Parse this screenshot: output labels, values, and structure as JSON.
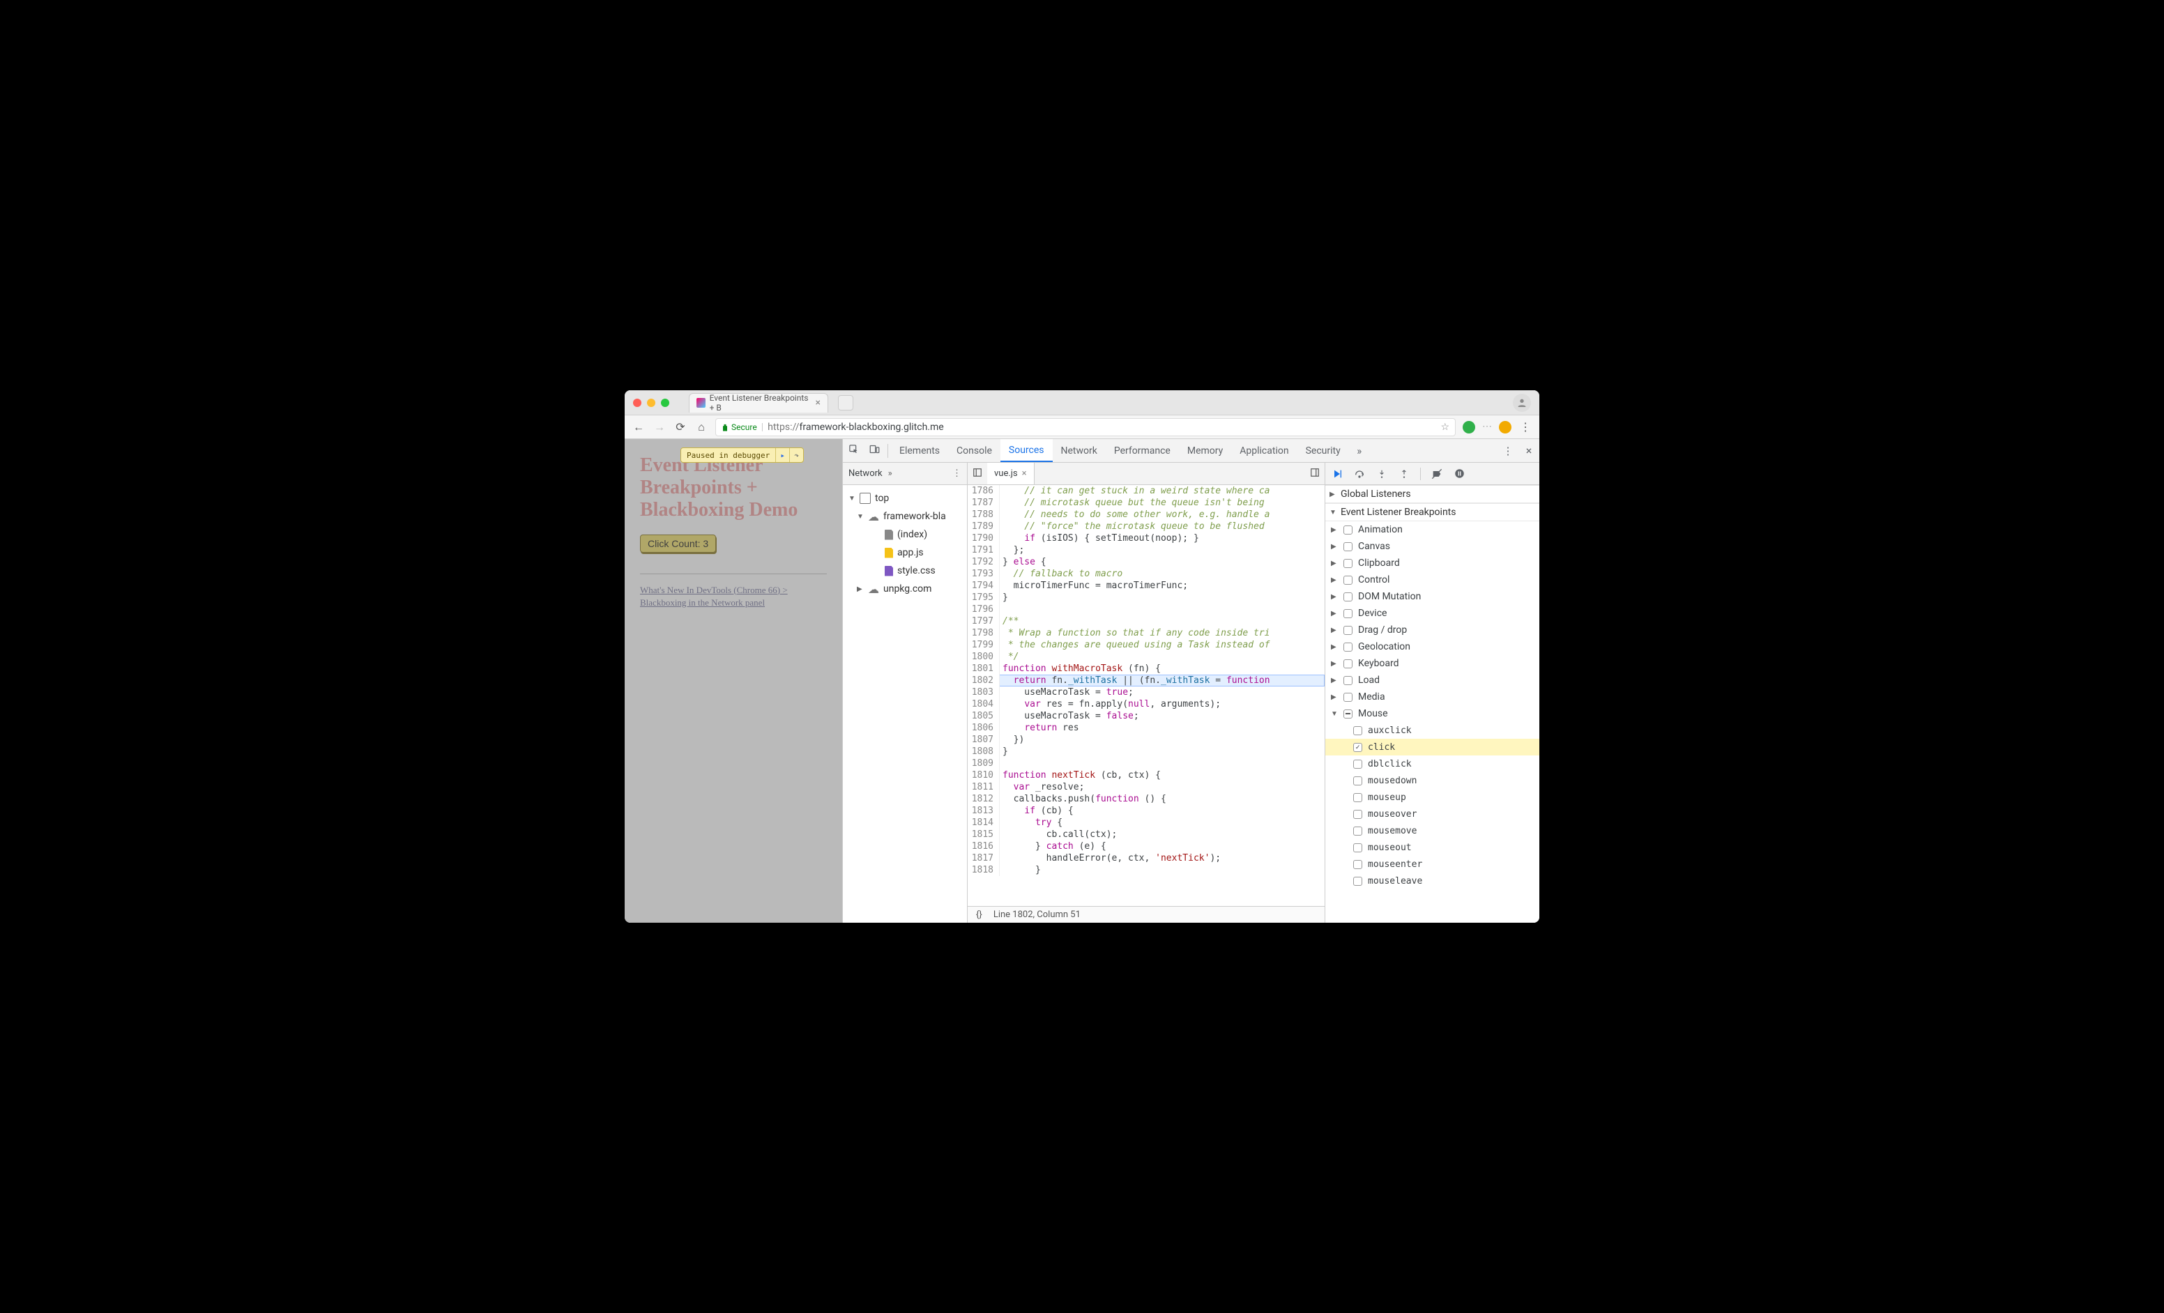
{
  "browser": {
    "tab_title": "Event Listener Breakpoints + B",
    "secure_label": "Secure",
    "url_scheme": "https://",
    "url_host_path": "framework-blackboxing.glitch.me"
  },
  "page": {
    "paused_label": "Paused in debugger",
    "heading": "Event Listener Breakpoints + Blackboxing Demo",
    "click_button": "Click Count: 3",
    "link_text": "What's New In DevTools (Chrome 66) > Blackboxing in the Network panel"
  },
  "devtools": {
    "tabs": [
      "Elements",
      "Console",
      "Sources",
      "Network",
      "Performance",
      "Memory",
      "Application",
      "Security"
    ],
    "active_tab": "Sources",
    "overflow": "»"
  },
  "navigator": {
    "tab": "Network",
    "overflow": "»",
    "tree": {
      "top": "top",
      "host": "framework-bla",
      "files": [
        "(index)",
        "app.js",
        "style.css"
      ],
      "other_host": "unpkg.com"
    }
  },
  "editor": {
    "tab": "vue.js",
    "status_braces": "{}",
    "status_pos": "Line 1802, Column 51",
    "first_line_no": 1786,
    "highlight_line": 1802,
    "lines": [
      {
        "cls": "c-com",
        "t": "    // it can get stuck in a weird state where ca"
      },
      {
        "cls": "c-com",
        "t": "    // microtask queue but the queue isn't being"
      },
      {
        "cls": "c-com",
        "t": "    // needs to do some other work, e.g. handle a"
      },
      {
        "cls": "c-com",
        "t": "    // \"force\" the microtask queue to be flushed"
      },
      {
        "raw": "    <span class='c-kw'>if</span> (isIOS) { setTimeout(noop); }"
      },
      {
        "raw": "  };"
      },
      {
        "raw": "} <span class='c-kw'>else</span> {"
      },
      {
        "cls": "c-com",
        "t": "  // fallback to macro"
      },
      {
        "raw": "  microTimerFunc = macroTimerFunc;"
      },
      {
        "raw": "}"
      },
      {
        "raw": ""
      },
      {
        "cls": "c-com",
        "t": "/**"
      },
      {
        "cls": "c-com",
        "t": " * Wrap a function so that if any code inside tri"
      },
      {
        "cls": "c-com",
        "t": " * the changes are queued using a Task instead of"
      },
      {
        "cls": "c-com",
        "t": " */"
      },
      {
        "raw": "<span class='c-kw'>function</span> <span class='c-fn'>withMacroTask</span> (fn) {"
      },
      {
        "raw": "  <span class='c-kw'>return</span> fn.<span class='c-id'>_withTask</span> || (fn.<span class='c-id'>_withTask</span> = <span class='c-kw'>function</span>"
      },
      {
        "raw": "    useMacroTask = <span class='c-kw'>true</span>;"
      },
      {
        "raw": "    <span class='c-kw'>var</span> res = fn.apply(<span class='c-kw'>null</span>, arguments);"
      },
      {
        "raw": "    useMacroTask = <span class='c-kw'>false</span>;"
      },
      {
        "raw": "    <span class='c-kw'>return</span> res"
      },
      {
        "raw": "  })"
      },
      {
        "raw": "}"
      },
      {
        "raw": ""
      },
      {
        "raw": "<span class='c-kw'>function</span> <span class='c-fn'>nextTick</span> (cb, ctx) {"
      },
      {
        "raw": "  <span class='c-kw'>var</span> _resolve;"
      },
      {
        "raw": "  callbacks.push(<span class='c-kw'>function</span> () {"
      },
      {
        "raw": "    <span class='c-kw'>if</span> (cb) {"
      },
      {
        "raw": "      <span class='c-kw'>try</span> {"
      },
      {
        "raw": "        cb.call(ctx);"
      },
      {
        "raw": "      } <span class='c-kw'>catch</span> (e) {"
      },
      {
        "raw": "        handleError(e, ctx, <span class='c-str'>'nextTick'</span>);"
      },
      {
        "raw": "      }"
      }
    ]
  },
  "debugger": {
    "toolbar_icons": [
      "resume",
      "step-over",
      "step-into",
      "step-out",
      "sep",
      "deactivate",
      "pause-exceptions"
    ],
    "pane_global": "Global Listeners",
    "pane_elb": "Event Listener Breakpoints",
    "categories": [
      {
        "label": "Animation",
        "expanded": false
      },
      {
        "label": "Canvas",
        "expanded": false
      },
      {
        "label": "Clipboard",
        "expanded": false
      },
      {
        "label": "Control",
        "expanded": false
      },
      {
        "label": "DOM Mutation",
        "expanded": false
      },
      {
        "label": "Device",
        "expanded": false
      },
      {
        "label": "Drag / drop",
        "expanded": false
      },
      {
        "label": "Geolocation",
        "expanded": false
      },
      {
        "label": "Keyboard",
        "expanded": false
      },
      {
        "label": "Load",
        "expanded": false
      },
      {
        "label": "Media",
        "expanded": false
      },
      {
        "label": "Mouse",
        "expanded": true,
        "mixed": true,
        "events": [
          {
            "name": "auxclick",
            "checked": false
          },
          {
            "name": "click",
            "checked": true,
            "selected": true
          },
          {
            "name": "dblclick",
            "checked": false
          },
          {
            "name": "mousedown",
            "checked": false
          },
          {
            "name": "mouseup",
            "checked": false
          },
          {
            "name": "mouseover",
            "checked": false
          },
          {
            "name": "mousemove",
            "checked": false
          },
          {
            "name": "mouseout",
            "checked": false
          },
          {
            "name": "mouseenter",
            "checked": false
          },
          {
            "name": "mouseleave",
            "checked": false
          }
        ]
      }
    ]
  }
}
